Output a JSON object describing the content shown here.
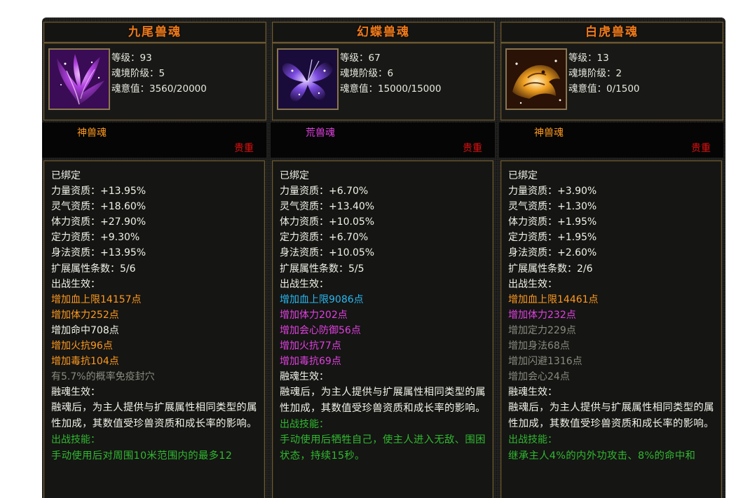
{
  "colors": {
    "orange": "#ff9a1e",
    "white": "#f2f2ea",
    "cyan": "#28b8f0",
    "magenta": "#e040e0",
    "gray": "#8a8a80",
    "green": "#30b830",
    "red": "#e01010",
    "title": "#f07a1a"
  },
  "labels": {
    "level": "等级：",
    "realm": "魂境阶级：",
    "intent": "魂意值：",
    "rarity": "贵重",
    "bound": "已绑定",
    "battle_effect": "出战生效：",
    "fusion_effect": "融魂生效：",
    "fusion_desc": "融魂后，为主人提供与扩展属性相同类型的属性加成，其数值受珍兽资质和成长率的影响。",
    "skill": "出战技能："
  },
  "cards": [
    {
      "name": "九尾兽魂",
      "icon": "nine-tail-fox-icon",
      "level": "93",
      "realm": "5",
      "intent": "3560/20000",
      "soul_type": "神兽魂",
      "soul_type_color": "#ff9a1e",
      "aptitudes": [
        "力量资质：+13.95%",
        "灵气资质：+18.60%",
        "体力资质：+27.90%",
        "定力资质：+9.30%",
        "身法资质：+13.95%",
        "扩展属性条数：5/6"
      ],
      "effects": [
        {
          "text": "增加血上限14157点",
          "color": "#ff9a1e"
        },
        {
          "text": "增加体力252点",
          "color": "#ff9a1e"
        },
        {
          "text": "增加命中708点",
          "color": "#f2f2ea"
        },
        {
          "text": "增加火抗96点",
          "color": "#ff9a1e"
        },
        {
          "text": "增加毒抗104点",
          "color": "#ff9a1e"
        },
        {
          "text": "有5.7%的概率免疫封穴",
          "color": "#8a8a80"
        }
      ],
      "skill_desc": "手动使用后对周围10米范围内的最多12"
    },
    {
      "name": "幻蝶兽魂",
      "icon": "butterfly-icon",
      "level": "67",
      "realm": "6",
      "intent": "15000/15000",
      "soul_type": "荒兽魂",
      "soul_type_color": "#e040e0",
      "aptitudes": [
        "力量资质：+6.70%",
        "灵气资质：+13.40%",
        "体力资质：+10.05%",
        "定力资质：+6.70%",
        "身法资质：+10.05%",
        "扩展属性条数：5/5"
      ],
      "effects": [
        {
          "text": "增加血上限9086点",
          "color": "#28b8f0"
        },
        {
          "text": "增加体力202点",
          "color": "#e040e0"
        },
        {
          "text": "增加会心防御56点",
          "color": "#e040e0"
        },
        {
          "text": "增加火抗77点",
          "color": "#e040e0"
        },
        {
          "text": "增加毒抗69点",
          "color": "#e040e0"
        }
      ],
      "skill_desc": "手动使用后牺牲自己，使主人进入无敌、围困状态，持续15秒。"
    },
    {
      "name": "白虎兽魂",
      "icon": "white-tiger-icon",
      "level": "13",
      "realm": "2",
      "intent": "0/1500",
      "soul_type": "神兽魂",
      "soul_type_color": "#ff9a1e",
      "aptitudes": [
        "力量资质：+3.90%",
        "灵气资质：+1.30%",
        "体力资质：+1.95%",
        "定力资质：+1.95%",
        "身法资质：+2.60%",
        "扩展属性条数：2/6"
      ],
      "effects": [
        {
          "text": "增加血上限14461点",
          "color": "#ff9a1e"
        },
        {
          "text": "增加体力232点",
          "color": "#e040e0"
        },
        {
          "text": "增加定力229点",
          "color": "#8a8a80"
        },
        {
          "text": "增加身法68点",
          "color": "#8a8a80"
        },
        {
          "text": "增加闪避1316点",
          "color": "#8a8a80"
        },
        {
          "text": "增加会心24点",
          "color": "#8a8a80"
        }
      ],
      "skill_desc": "继承主人4%的内外功攻击、8%的命中和"
    }
  ]
}
